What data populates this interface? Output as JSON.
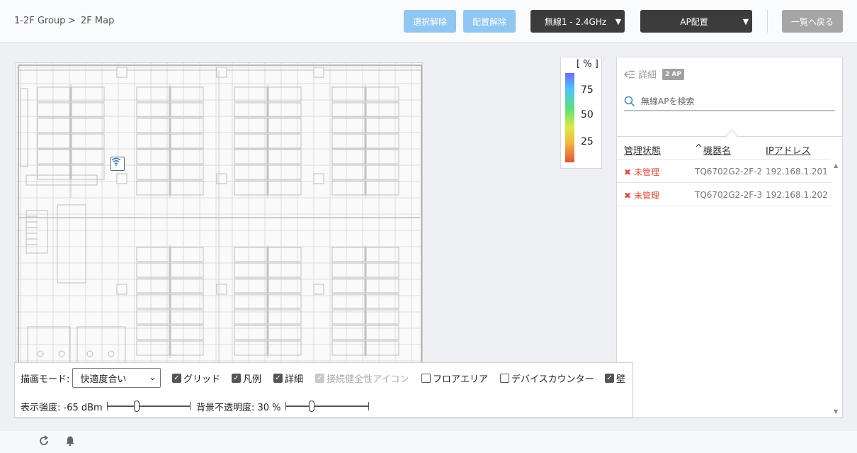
{
  "breadcrumb": {
    "group": "1-2F Group",
    "separator": ">",
    "current": "2F Map"
  },
  "toolbar": {
    "deselect": "選択解除",
    "unplace": "配置解除",
    "radio_select": "無線1 - 2.4GHz",
    "ap_place": "AP配置",
    "back_to_list": "一覧へ戻る",
    "dropdown_arrow": "▼"
  },
  "legend": {
    "unit": "[ % ]",
    "ticks": [
      "75",
      "50",
      "25"
    ]
  },
  "panel": {
    "title": "詳細",
    "ap_count": "2 AP",
    "search_placeholder": "無線APを検索",
    "columns": {
      "state": "管理状態",
      "sort_indicator": "^",
      "device": "機器名",
      "ip": "IPアドレス"
    },
    "rows": [
      {
        "state": "未管理",
        "device": "TQ6702G2-2F-2",
        "ip": "192.168.1.201"
      },
      {
        "state": "未管理",
        "device": "TQ6702G2-2F-3",
        "ip": "192.168.1.202"
      }
    ]
  },
  "controls": {
    "draw_mode_label": "描画モード:",
    "draw_mode_value": "快適度合い",
    "checkboxes": {
      "grid": "グリッド",
      "legend": "凡例",
      "detail": "詳細",
      "health_icon": "接続健全性アイコン",
      "floor_area": "フロアエリア",
      "device_counter": "デバイスカウンター",
      "wall": "壁"
    },
    "checked": {
      "grid": true,
      "legend": true,
      "detail": true,
      "health_icon": true,
      "floor_area": false,
      "device_counter": false,
      "wall": true
    },
    "strength_label": "表示強度: -65 dBm",
    "strength_fraction": 0.35,
    "opacity_label": "背景不透明度: 30 %",
    "opacity_fraction": 0.3
  },
  "icons": {
    "list_collapse": "list-collapse-icon",
    "search": "search-icon",
    "delete": "x-icon",
    "wifi": "wifi-icon",
    "refresh": "refresh-icon",
    "bell": "bell-icon"
  },
  "colors": {
    "light_button": "#8fc6f2",
    "dark_button": "#3c3c3c",
    "gray_button": "#a6a6a6",
    "unmanaged": "#e04a3c"
  }
}
